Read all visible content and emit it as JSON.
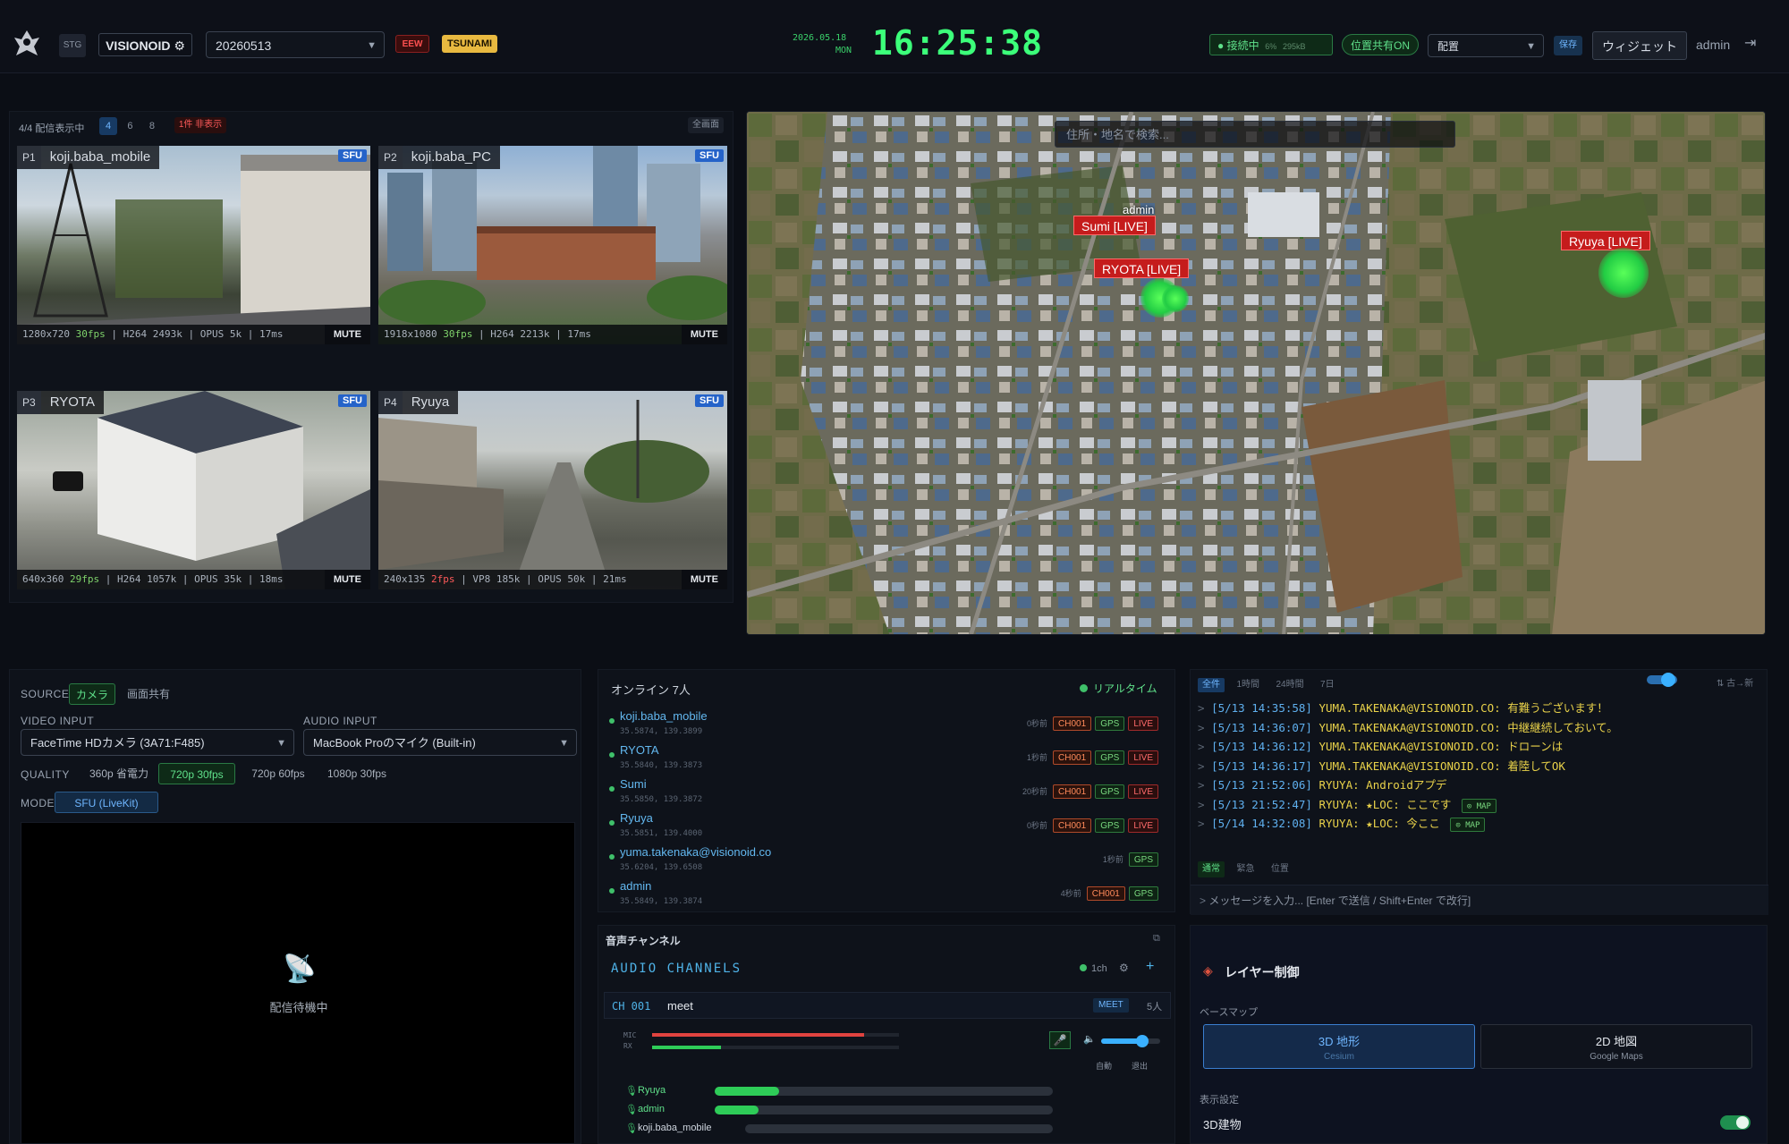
{
  "header": {
    "env_badge": "STG",
    "app_name": "VISIONOID",
    "date_select": "20260513",
    "badge_eew": "EEW",
    "badge_tsunami": "TSUNAMI",
    "date_display": "2026.05.18",
    "weekday": "MON",
    "clock": "16:25:38",
    "connection_status": "● 接続中",
    "connection_count": "6%",
    "connection_bitrate": "295kB",
    "location_share": "位置共有ON",
    "layout_select": "配置",
    "save_label": "保存",
    "widget_label": "ウィジェット",
    "user": "admin"
  },
  "streams": {
    "count_label": "4/4 配信表示中",
    "grid_options": [
      "4",
      "6",
      "8"
    ],
    "hidden_label": "1件 非表示",
    "all_label": "全画面",
    "tiles": [
      {
        "id": "P1",
        "name": "koji.baba_mobile",
        "res": "1280x720",
        "fps": "30fps",
        "vcodec": "H264 2493k",
        "acodec": "OPUS 5k",
        "latency": "17ms",
        "badge": "SFU",
        "mute": "MUTE"
      },
      {
        "id": "P2",
        "name": "koji.baba_PC",
        "res": "1918x1080",
        "fps": "30fps",
        "vcodec": "H264 2213k",
        "acodec": "",
        "latency": "17ms",
        "badge": "SFU",
        "mute": "MUTE"
      },
      {
        "id": "P3",
        "name": "RYOTA",
        "res": "640x360",
        "fps": "29fps",
        "vcodec": "H264 1057k",
        "acodec": "OPUS 35k",
        "latency": "18ms",
        "badge": "SFU",
        "mute": "MUTE"
      },
      {
        "id": "P4",
        "name": "Ryuya",
        "res": "240x135",
        "fps": "2fps",
        "vcodec": "VP8 185k",
        "acodec": "OPUS 50k",
        "latency": "21ms",
        "badge": "SFU",
        "mute": "MUTE"
      }
    ]
  },
  "map": {
    "search_placeholder": "住所・地名で検索...",
    "markers": [
      {
        "label": "Sumi [LIVE]",
        "sub": "admin"
      },
      {
        "label": "RYOTA [LIVE]"
      },
      {
        "label": "Ryuya [LIVE]"
      }
    ]
  },
  "source": {
    "source_label": "SOURCE",
    "camera_btn": "カメラ",
    "screen_btn": "画面共有",
    "video_input_label": "VIDEO INPUT",
    "video_input_value": "FaceTime HDカメラ (3A71:F485)",
    "audio_input_label": "AUDIO INPUT",
    "audio_input_value": "MacBook Proのマイク (Built-in)",
    "quality_label": "QUALITY",
    "quality_options": [
      "360p 省電力",
      "720p 30fps",
      "720p 60fps",
      "1080p 30fps"
    ],
    "mode_label": "MODE",
    "mode_value": "SFU (LiveKit)",
    "preview_status": "配信待機中"
  },
  "online": {
    "title": "オンライン 7人",
    "realtime": "リアルタイム",
    "users": [
      {
        "name": "koji.baba_mobile",
        "coords": "35.5874, 139.3899",
        "ago": "0秒前",
        "ch": "CH001",
        "gps": "GPS",
        "live": "LIVE"
      },
      {
        "name": "RYOTA",
        "coords": "35.5840, 139.3873",
        "ago": "1秒前",
        "ch": "CH001",
        "gps": "GPS",
        "live": "LIVE"
      },
      {
        "name": "Sumi",
        "coords": "35.5850, 139.3872",
        "ago": "20秒前",
        "ch": "CH001",
        "gps": "GPS",
        "live": "LIVE"
      },
      {
        "name": "Ryuya",
        "coords": "35.5851, 139.4000",
        "ago": "0秒前",
        "ch": "CH001",
        "gps": "GPS",
        "live": "LIVE"
      },
      {
        "name": "yuma.takenaka@visionoid.co",
        "coords": "35.6204, 139.6508",
        "ago": "1秒前",
        "ch": "",
        "gps": "GPS",
        "live": ""
      },
      {
        "name": "admin",
        "coords": "35.5849, 139.3874",
        "ago": "4秒前",
        "ch": "CH001",
        "gps": "GPS",
        "live": ""
      }
    ]
  },
  "chat": {
    "filters": [
      "全件",
      "1時間",
      "24時間",
      "7日"
    ],
    "clear_label": "⇅ 古→新",
    "messages": [
      {
        "ts": "[5/13 14:35:58]",
        "who": "YUMA.TAKENAKA@VISIONOID.CO:",
        "text": "有難うございます！"
      },
      {
        "ts": "[5/13 14:36:07]",
        "who": "YUMA.TAKENAKA@VISIONOID.CO:",
        "text": "中継継続しておいて。"
      },
      {
        "ts": "[5/13 14:36:12]",
        "who": "YUMA.TAKENAKA@VISIONOID.CO:",
        "text": "ドローンは"
      },
      {
        "ts": "[5/13 14:36:17]",
        "who": "YUMA.TAKENAKA@VISIONOID.CO:",
        "text": "着陸してOK"
      },
      {
        "ts": "[5/13 21:52:06]",
        "who": "RYUYA:",
        "text": "Androidアプデ"
      },
      {
        "ts": "[5/13 21:52:47]",
        "who": "RYUYA:",
        "text": "★LOC: ここです",
        "map": "⊙ MAP"
      },
      {
        "ts": "[5/14 14:32:08]",
        "who": "RYUYA:",
        "text": "★LOC: 今ここ",
        "map": "⊙ MAP"
      }
    ],
    "modes": [
      "通常",
      "緊急",
      "位置"
    ],
    "input_placeholder": "メッセージを入力... [Enter で送信 / Shift+Enter で改行]"
  },
  "audio": {
    "title_jp": "音声チャンネル",
    "title_en": "AUDIO CHANNELS",
    "count": "1ch",
    "channel_id": "CH 001",
    "channel_name": "meet",
    "channel_badge": "MEET",
    "channel_members": "5人",
    "mic_label": "MIC",
    "rx_label": "RX",
    "mic_level": 0.86,
    "rx_level": 0.28,
    "volume_level": 0.7,
    "right_a": "自動",
    "right_b": "退出",
    "members": [
      {
        "name": "Ryuya",
        "level": 0.19
      },
      {
        "name": "admin",
        "level": 0.13
      },
      {
        "name": "koji.baba_mobile",
        "level": 0.0
      }
    ]
  },
  "layers": {
    "title": "レイヤー制御",
    "basemap_label": "ベースマップ",
    "opt1_title": "3D 地形",
    "opt1_sub": "Cesium",
    "opt2_title": "2D 地図",
    "opt2_sub": "Google Maps",
    "display_label": "表示設定",
    "building_label": "3D建物"
  },
  "colors": {
    "accent": "#2ea8ff",
    "green": "#2ecc58",
    "live_red": "#c51c1c",
    "clock": "#3cff7a"
  }
}
